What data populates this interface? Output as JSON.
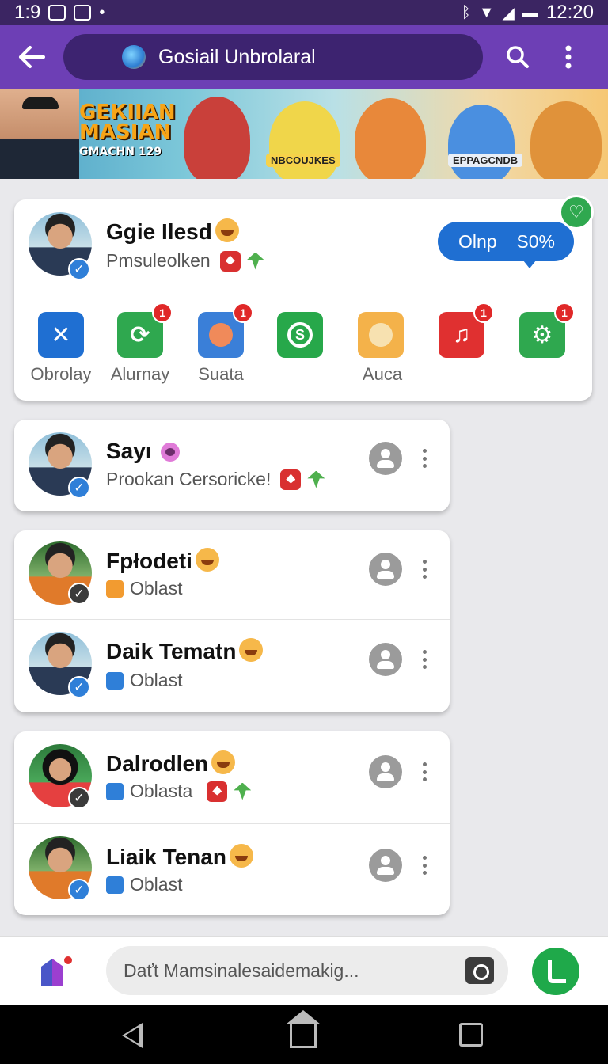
{
  "status_bar": {
    "time_left": "1:9",
    "time_right": "12:20"
  },
  "app_bar": {
    "title": "Gosiail Unbrolaral",
    "back_icon": "arrow-left-icon",
    "search_icon": "search-icon",
    "menu_icon": "more-vert-icon"
  },
  "banner": {
    "brand_line1": "GEКIIAN",
    "brand_line2": "MASIAN",
    "brand_sub": "GMACHN 129",
    "tag1": "NBCOUJKES",
    "tag2": "EPPAGCNDB"
  },
  "featured": {
    "name": "Ggie Ilesd",
    "subtitle": "Pmsuleolken",
    "online_label": "Olnp",
    "online_value": "S0%",
    "apps": [
      {
        "label": "Obrolay",
        "icon": "x-icon",
        "color": "#1f6fd2",
        "badge": ""
      },
      {
        "label": "Alurnay",
        "icon": "refresh-icon",
        "color": "#2fa84f",
        "badge": "1"
      },
      {
        "label": "Suata",
        "icon": "cat-icon",
        "color": "#3a7fd8",
        "badge": "1"
      },
      {
        "label": "",
        "icon": "skype-icon",
        "color": "#27a84a",
        "badge": ""
      },
      {
        "label": "Auca",
        "icon": "dog-icon",
        "color": "#f4b24a",
        "badge": ""
      },
      {
        "label": "",
        "icon": "music-icon",
        "color": "#e03030",
        "badge": "1"
      },
      {
        "label": "",
        "icon": "settings-icon",
        "color": "#2fa84f",
        "badge": "1"
      }
    ]
  },
  "contacts": [
    {
      "name": "Sayı",
      "subtitle": "Prookan Cersoricke!"
    },
    {
      "name": "Fpłodeti",
      "subtitle": "Oblast"
    },
    {
      "name": "Daik Tematn",
      "subtitle": "Oblast"
    },
    {
      "name": "Dalrodlen",
      "subtitle": "Oblasta"
    },
    {
      "name": "Liaik Tenan",
      "subtitle": "Oblast"
    }
  ],
  "composer": {
    "placeholder": "Daťt Mamsinalesaidemakig..."
  },
  "colors": {
    "app_bar": "#6d3fb5",
    "status_bar": "#3b2562",
    "accent_blue": "#1f6fd2",
    "accent_green": "#2fa84f"
  }
}
